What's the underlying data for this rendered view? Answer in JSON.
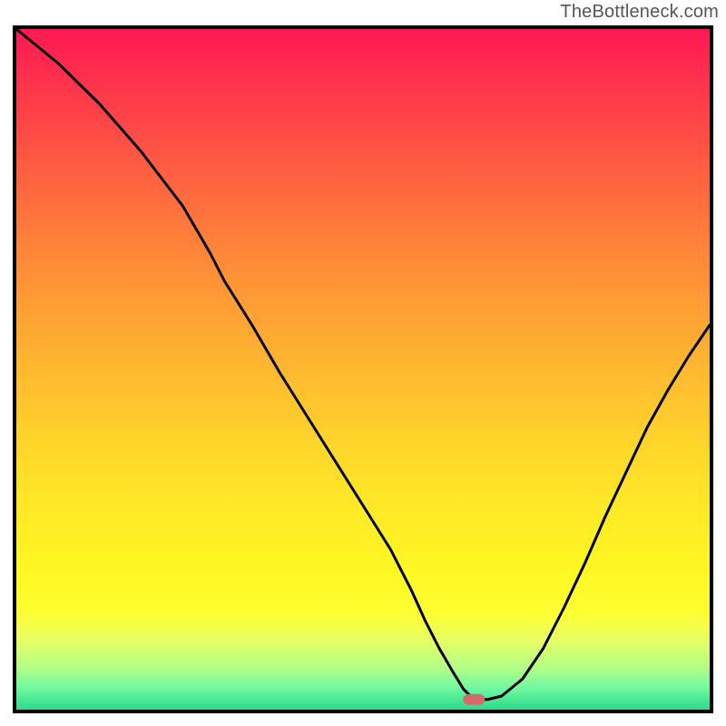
{
  "attribution": "TheBottleneck.com",
  "chart_data": {
    "type": "line",
    "title": "",
    "xlabel": "",
    "ylabel": "",
    "xlim": [
      0,
      100
    ],
    "ylim": [
      0,
      100
    ],
    "grid": false,
    "legend": false,
    "x": [
      0,
      3,
      6,
      9,
      12,
      15,
      18,
      21,
      24,
      26,
      28,
      30,
      34,
      38,
      42,
      46,
      50,
      54,
      57,
      59,
      61,
      63,
      64.5,
      66,
      68,
      70,
      73,
      76,
      79,
      82,
      85,
      88,
      91,
      94,
      97,
      100
    ],
    "values": [
      100,
      97.5,
      95,
      92,
      89,
      85.5,
      82,
      78,
      74,
      70.5,
      67,
      63,
      56.5,
      49.5,
      43,
      36.5,
      30,
      23.5,
      17.5,
      13,
      9,
      5.5,
      3,
      1.5,
      1.5,
      2,
      4.5,
      9,
      15,
      21.5,
      28.5,
      35,
      41.5,
      47,
      52,
      56.5
    ],
    "background_gradient": {
      "stops": [
        {
          "offset": 0.0,
          "color": "#ff1954"
        },
        {
          "offset": 0.1,
          "color": "#ff3a4a"
        },
        {
          "offset": 0.2,
          "color": "#ff5c42"
        },
        {
          "offset": 0.3,
          "color": "#ff7d3b"
        },
        {
          "offset": 0.4,
          "color": "#ff9c35"
        },
        {
          "offset": 0.5,
          "color": "#ffb830"
        },
        {
          "offset": 0.6,
          "color": "#ffd32b"
        },
        {
          "offset": 0.7,
          "color": "#ffe827"
        },
        {
          "offset": 0.8,
          "color": "#fff823"
        },
        {
          "offset": 0.86,
          "color": "#fdff34"
        },
        {
          "offset": 0.9,
          "color": "#e5ff66"
        },
        {
          "offset": 0.94,
          "color": "#b0ff88"
        },
        {
          "offset": 0.97,
          "color": "#6cf8a0"
        },
        {
          "offset": 1.0,
          "color": "#2bd98a"
        }
      ]
    },
    "line_style": {
      "color": "#000000",
      "width": 3
    },
    "marker": {
      "x": 66,
      "y": 1.5,
      "color": "#d46a6a",
      "rx": 12,
      "ry": 6
    },
    "frame": {
      "color": "#000000",
      "width": 4
    }
  }
}
